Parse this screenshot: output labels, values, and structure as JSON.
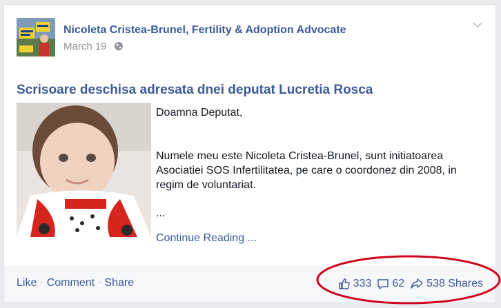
{
  "post": {
    "author": "Nicoleta Cristea-Brunel, Fertility & Adoption Advocate",
    "date": "March 19",
    "privacy_icon": "globe-icon",
    "menu_icon": "chevron-down-icon"
  },
  "article": {
    "title": "Scrisoare deschisa adresata dnei deputat Lucretia Rosca",
    "greeting": "Doamna Deputat,",
    "paragraph": "Numele meu este Nicoleta Cristea-Brunel, sunt initiatoarea Asociatiei SOS Infertilitatea, pe care o coordonez din 2008, in regim de voluntariat.",
    "ellipsis": "...",
    "continue_label": "Continue Reading ..."
  },
  "actions": {
    "like": "Like",
    "comment": "Comment",
    "share": "Share",
    "separator": "·"
  },
  "stats": {
    "likes": "333",
    "comments": "62",
    "shares": "538 Shares"
  },
  "colors": {
    "link": "#3b5998",
    "highlight": "#d0021b"
  }
}
